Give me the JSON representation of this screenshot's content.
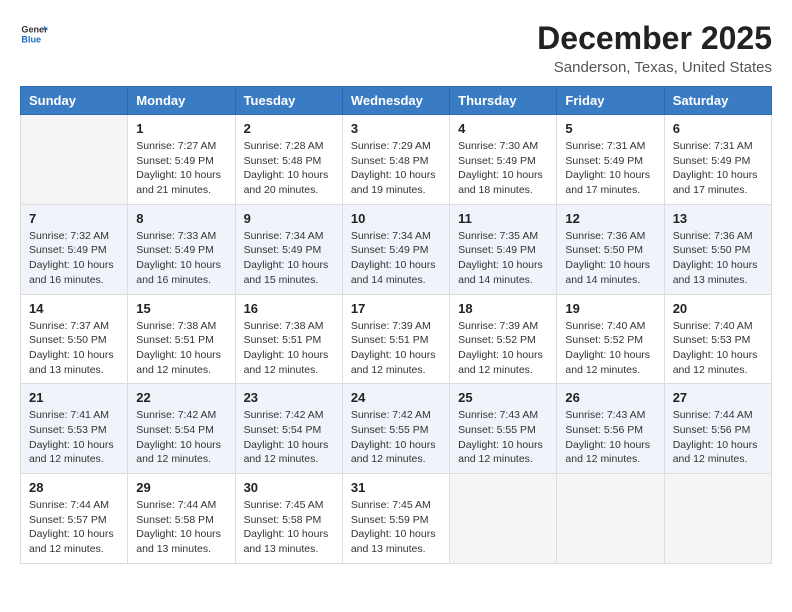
{
  "logo": {
    "general": "General",
    "blue": "Blue"
  },
  "title": "December 2025",
  "subtitle": "Sanderson, Texas, United States",
  "headers": [
    "Sunday",
    "Monday",
    "Tuesday",
    "Wednesday",
    "Thursday",
    "Friday",
    "Saturday"
  ],
  "weeks": [
    [
      {
        "day": "",
        "info": ""
      },
      {
        "day": "1",
        "info": "Sunrise: 7:27 AM\nSunset: 5:49 PM\nDaylight: 10 hours and 21 minutes."
      },
      {
        "day": "2",
        "info": "Sunrise: 7:28 AM\nSunset: 5:48 PM\nDaylight: 10 hours and 20 minutes."
      },
      {
        "day": "3",
        "info": "Sunrise: 7:29 AM\nSunset: 5:48 PM\nDaylight: 10 hours and 19 minutes."
      },
      {
        "day": "4",
        "info": "Sunrise: 7:30 AM\nSunset: 5:49 PM\nDaylight: 10 hours and 18 minutes."
      },
      {
        "day": "5",
        "info": "Sunrise: 7:31 AM\nSunset: 5:49 PM\nDaylight: 10 hours and 17 minutes."
      },
      {
        "day": "6",
        "info": "Sunrise: 7:31 AM\nSunset: 5:49 PM\nDaylight: 10 hours and 17 minutes."
      }
    ],
    [
      {
        "day": "7",
        "info": "Sunrise: 7:32 AM\nSunset: 5:49 PM\nDaylight: 10 hours and 16 minutes."
      },
      {
        "day": "8",
        "info": "Sunrise: 7:33 AM\nSunset: 5:49 PM\nDaylight: 10 hours and 16 minutes."
      },
      {
        "day": "9",
        "info": "Sunrise: 7:34 AM\nSunset: 5:49 PM\nDaylight: 10 hours and 15 minutes."
      },
      {
        "day": "10",
        "info": "Sunrise: 7:34 AM\nSunset: 5:49 PM\nDaylight: 10 hours and 14 minutes."
      },
      {
        "day": "11",
        "info": "Sunrise: 7:35 AM\nSunset: 5:49 PM\nDaylight: 10 hours and 14 minutes."
      },
      {
        "day": "12",
        "info": "Sunrise: 7:36 AM\nSunset: 5:50 PM\nDaylight: 10 hours and 14 minutes."
      },
      {
        "day": "13",
        "info": "Sunrise: 7:36 AM\nSunset: 5:50 PM\nDaylight: 10 hours and 13 minutes."
      }
    ],
    [
      {
        "day": "14",
        "info": "Sunrise: 7:37 AM\nSunset: 5:50 PM\nDaylight: 10 hours and 13 minutes."
      },
      {
        "day": "15",
        "info": "Sunrise: 7:38 AM\nSunset: 5:51 PM\nDaylight: 10 hours and 12 minutes."
      },
      {
        "day": "16",
        "info": "Sunrise: 7:38 AM\nSunset: 5:51 PM\nDaylight: 10 hours and 12 minutes."
      },
      {
        "day": "17",
        "info": "Sunrise: 7:39 AM\nSunset: 5:51 PM\nDaylight: 10 hours and 12 minutes."
      },
      {
        "day": "18",
        "info": "Sunrise: 7:39 AM\nSunset: 5:52 PM\nDaylight: 10 hours and 12 minutes."
      },
      {
        "day": "19",
        "info": "Sunrise: 7:40 AM\nSunset: 5:52 PM\nDaylight: 10 hours and 12 minutes."
      },
      {
        "day": "20",
        "info": "Sunrise: 7:40 AM\nSunset: 5:53 PM\nDaylight: 10 hours and 12 minutes."
      }
    ],
    [
      {
        "day": "21",
        "info": "Sunrise: 7:41 AM\nSunset: 5:53 PM\nDaylight: 10 hours and 12 minutes."
      },
      {
        "day": "22",
        "info": "Sunrise: 7:42 AM\nSunset: 5:54 PM\nDaylight: 10 hours and 12 minutes."
      },
      {
        "day": "23",
        "info": "Sunrise: 7:42 AM\nSunset: 5:54 PM\nDaylight: 10 hours and 12 minutes."
      },
      {
        "day": "24",
        "info": "Sunrise: 7:42 AM\nSunset: 5:55 PM\nDaylight: 10 hours and 12 minutes."
      },
      {
        "day": "25",
        "info": "Sunrise: 7:43 AM\nSunset: 5:55 PM\nDaylight: 10 hours and 12 minutes."
      },
      {
        "day": "26",
        "info": "Sunrise: 7:43 AM\nSunset: 5:56 PM\nDaylight: 10 hours and 12 minutes."
      },
      {
        "day": "27",
        "info": "Sunrise: 7:44 AM\nSunset: 5:56 PM\nDaylight: 10 hours and 12 minutes."
      }
    ],
    [
      {
        "day": "28",
        "info": "Sunrise: 7:44 AM\nSunset: 5:57 PM\nDaylight: 10 hours and 12 minutes."
      },
      {
        "day": "29",
        "info": "Sunrise: 7:44 AM\nSunset: 5:58 PM\nDaylight: 10 hours and 13 minutes."
      },
      {
        "day": "30",
        "info": "Sunrise: 7:45 AM\nSunset: 5:58 PM\nDaylight: 10 hours and 13 minutes."
      },
      {
        "day": "31",
        "info": "Sunrise: 7:45 AM\nSunset: 5:59 PM\nDaylight: 10 hours and 13 minutes."
      },
      {
        "day": "",
        "info": ""
      },
      {
        "day": "",
        "info": ""
      },
      {
        "day": "",
        "info": ""
      }
    ]
  ]
}
